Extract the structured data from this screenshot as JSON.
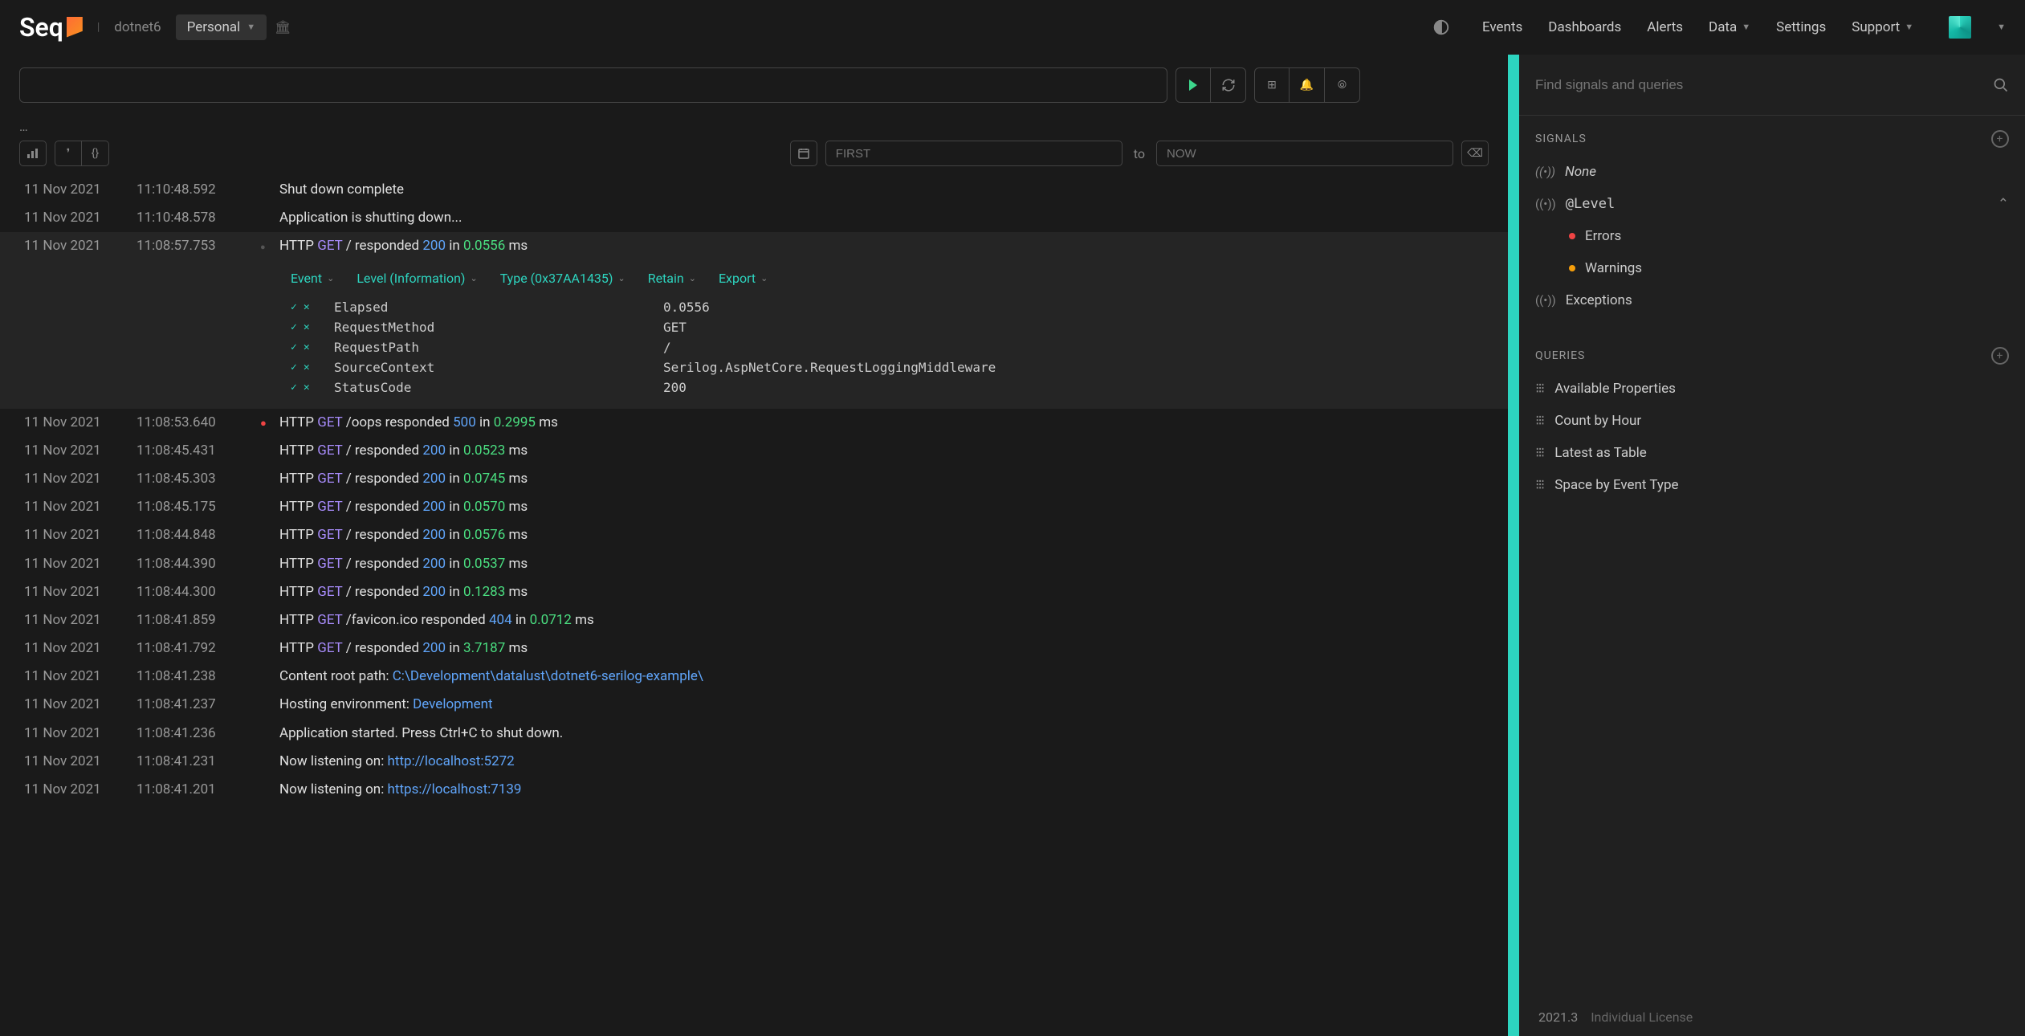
{
  "header": {
    "logo_text": "Seq",
    "crumb": "dotnet6",
    "workspace": "Personal",
    "nav": {
      "events": "Events",
      "dashboards": "Dashboards",
      "alerts": "Alerts",
      "data": "Data",
      "settings": "Settings",
      "support": "Support"
    }
  },
  "filter_bar": {
    "from_placeholder": "FIRST",
    "to_label": "to",
    "to_placeholder": "NOW"
  },
  "expanded": {
    "toolbar": {
      "event": "Event",
      "level": "Level (Information)",
      "type": "Type (0x37AA1435)",
      "retain": "Retain",
      "export": "Export"
    },
    "props": [
      {
        "key": "Elapsed",
        "val": "0.0556"
      },
      {
        "key": "RequestMethod",
        "val": "GET"
      },
      {
        "key": "RequestPath",
        "val": "/"
      },
      {
        "key": "SourceContext",
        "val": "Serilog.AspNetCore.RequestLoggingMiddleware"
      },
      {
        "key": "StatusCode",
        "val": "200"
      }
    ]
  },
  "events": [
    {
      "date": "11 Nov 2021",
      "time": "11:10:48.592",
      "dot": "",
      "type": "plain",
      "msg": "Shut down complete"
    },
    {
      "date": "11 Nov 2021",
      "time": "11:10:48.578",
      "dot": "",
      "type": "plain",
      "msg": "Application is shutting down..."
    },
    {
      "date": "11 Nov 2021",
      "time": "11:08:57.753",
      "dot": "gray",
      "type": "http",
      "method": "GET",
      "path": "/",
      "status": "200",
      "elapsed": "0.0556",
      "expanded": true
    },
    {
      "date": "11 Nov 2021",
      "time": "11:08:53.640",
      "dot": "red",
      "type": "http",
      "method": "GET",
      "path": "/oops",
      "status": "500",
      "elapsed": "0.2995"
    },
    {
      "date": "11 Nov 2021",
      "time": "11:08:45.431",
      "dot": "",
      "type": "http",
      "method": "GET",
      "path": "/",
      "status": "200",
      "elapsed": "0.0523"
    },
    {
      "date": "11 Nov 2021",
      "time": "11:08:45.303",
      "dot": "",
      "type": "http",
      "method": "GET",
      "path": "/",
      "status": "200",
      "elapsed": "0.0745"
    },
    {
      "date": "11 Nov 2021",
      "time": "11:08:45.175",
      "dot": "",
      "type": "http",
      "method": "GET",
      "path": "/",
      "status": "200",
      "elapsed": "0.0570"
    },
    {
      "date": "11 Nov 2021",
      "time": "11:08:44.848",
      "dot": "",
      "type": "http",
      "method": "GET",
      "path": "/",
      "status": "200",
      "elapsed": "0.0576"
    },
    {
      "date": "11 Nov 2021",
      "time": "11:08:44.390",
      "dot": "",
      "type": "http",
      "method": "GET",
      "path": "/",
      "status": "200",
      "elapsed": "0.0537"
    },
    {
      "date": "11 Nov 2021",
      "time": "11:08:44.300",
      "dot": "",
      "type": "http",
      "method": "GET",
      "path": "/",
      "status": "200",
      "elapsed": "0.1283"
    },
    {
      "date": "11 Nov 2021",
      "time": "11:08:41.859",
      "dot": "",
      "type": "http",
      "method": "GET",
      "path": "/favicon.ico",
      "status": "404",
      "elapsed": "0.0712"
    },
    {
      "date": "11 Nov 2021",
      "time": "11:08:41.792",
      "dot": "",
      "type": "http",
      "method": "GET",
      "path": "/",
      "status": "200",
      "elapsed": "3.7187"
    },
    {
      "date": "11 Nov 2021",
      "time": "11:08:41.238",
      "dot": "",
      "type": "text_link",
      "prefix": "Content root path: ",
      "link": "C:\\Development\\datalust\\dotnet6-serilog-example\\"
    },
    {
      "date": "11 Nov 2021",
      "time": "11:08:41.237",
      "dot": "",
      "type": "text_link",
      "prefix": "Hosting environment: ",
      "link": "Development"
    },
    {
      "date": "11 Nov 2021",
      "time": "11:08:41.236",
      "dot": "",
      "type": "plain",
      "msg": "Application started. Press Ctrl+C to shut down."
    },
    {
      "date": "11 Nov 2021",
      "time": "11:08:41.231",
      "dot": "",
      "type": "text_link",
      "prefix": "Now listening on: ",
      "link": "http://localhost:5272"
    },
    {
      "date": "11 Nov 2021",
      "time": "11:08:41.201",
      "dot": "",
      "type": "text_link",
      "prefix": "Now listening on: ",
      "link": "https://localhost:7139"
    }
  ],
  "sidebar": {
    "search_placeholder": "Find signals and queries",
    "signals_header": "SIGNALS",
    "signals": {
      "none": "None",
      "level": "@Level",
      "errors": "Errors",
      "warnings": "Warnings",
      "exceptions": "Exceptions"
    },
    "queries_header": "QUERIES",
    "queries": [
      "Available Properties",
      "Count by Hour",
      "Latest as Table",
      "Space by Event Type"
    ]
  },
  "footer": {
    "version": "2021.3",
    "license": "Individual License"
  }
}
